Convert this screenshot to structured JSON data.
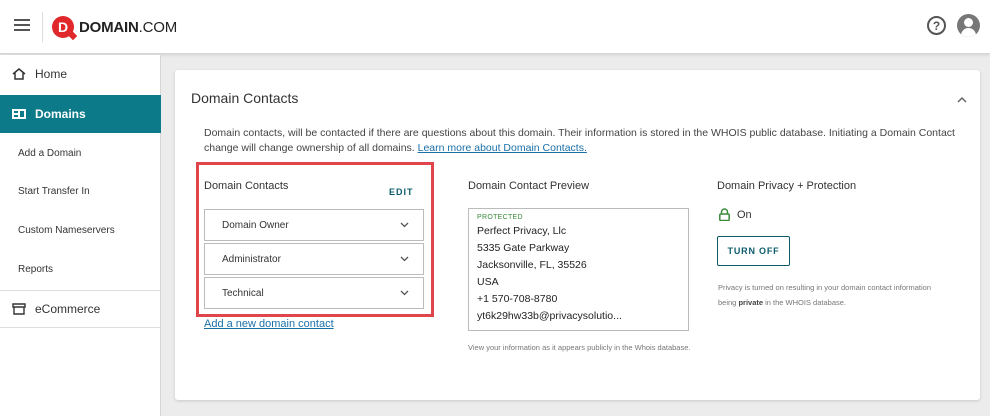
{
  "header": {
    "logo_text": "DOMAIN",
    "logo_suffix": ".COM",
    "logo_mark": "D"
  },
  "sidebar": {
    "items": [
      {
        "label": "Home",
        "icon": "home-icon"
      },
      {
        "label": "Domains",
        "icon": "domains-icon"
      },
      {
        "label": "Add a Domain"
      },
      {
        "label": "Start Transfer In"
      },
      {
        "label": "Custom Nameservers"
      },
      {
        "label": "Reports"
      },
      {
        "label": "eCommerce",
        "icon": "store-icon"
      }
    ],
    "active_color": "#0d7a8a"
  },
  "card": {
    "title": "Domain Contacts",
    "intro_text": "Domain contacts, will be contacted if there are questions about this domain. Their information is stored in the WHOIS public database. Initiating a Domain Contact change will change ownership of all domains. ",
    "intro_link": "Learn more about Domain Contacts."
  },
  "contacts": {
    "title": "Domain Contacts",
    "edit_label": "EDIT",
    "rows": [
      "Domain Owner",
      "Administrator",
      "Technical"
    ],
    "add_link": "Add a new domain contact"
  },
  "preview": {
    "title": "Domain Contact Preview",
    "badge": "PROTECTED",
    "lines": [
      "Perfect Privacy, Llc",
      "5335 Gate Parkway",
      "Jacksonville, FL, 35526",
      "USA",
      "+1 570-708-8780",
      "yt6k29hw33b@privacysolutio..."
    ],
    "note": "View your information as it appears publicly in the Whois database."
  },
  "privacy": {
    "title": "Domain Privacy + Protection",
    "status": "On",
    "button_label": "TURN OFF",
    "note_pre": "Privacy is turned on resulting in your domain contact information being ",
    "note_bold": "private",
    "note_post": " in the WHOIS database."
  },
  "colors": {
    "brand_red": "#e0282a",
    "accent_teal": "#0d7a8a",
    "highlight": "#e0454b"
  }
}
